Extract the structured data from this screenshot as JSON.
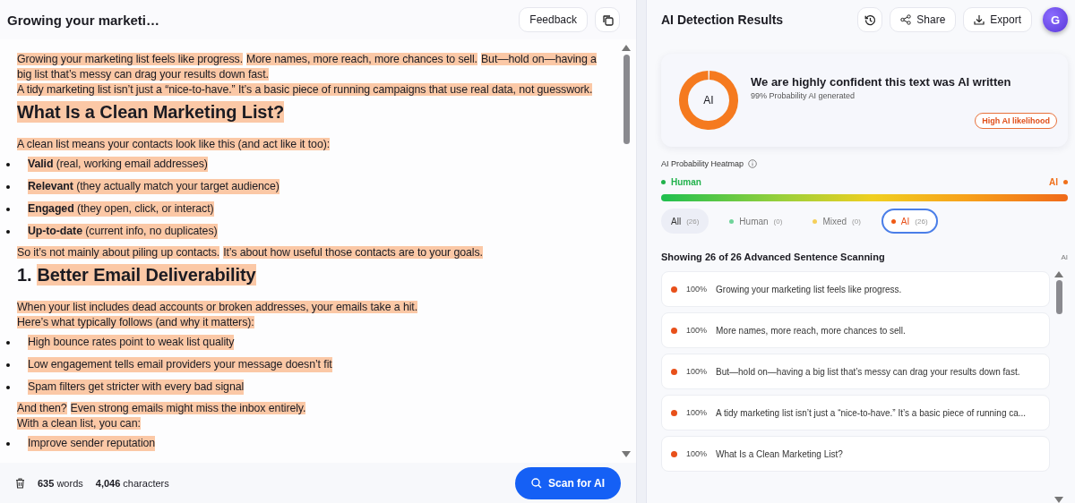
{
  "editor": {
    "title": "Growing your marketi…",
    "feedback_button": "Feedback",
    "blocks": [
      {
        "kind": "paragraph",
        "highlighted": true,
        "lines": [
          [
            "Growing your marketing list feels like progress.",
            "More names, more reach, more chances to sell.",
            "But—hold on—having a big list that’s messy can drag your results down fast."
          ],
          [
            "A tidy marketing list isn’t just a “nice-to-have.” It’s a basic piece of running campaigns that use real data, not guesswork."
          ]
        ]
      },
      {
        "kind": "heading",
        "highlighted": true,
        "text": "What Is a Clean Marketing List?"
      },
      {
        "kind": "paragraph",
        "highlighted": true,
        "lines": [
          [
            "A clean list means your contacts look like this (and act like it too):"
          ]
        ]
      },
      {
        "kind": "bullet",
        "highlighted": true,
        "text": "**Valid** (real, working email addresses)"
      },
      {
        "kind": "bullet",
        "highlighted": true,
        "text": "**Relevant** (they actually match your target audience)"
      },
      {
        "kind": "bullet",
        "highlighted": true,
        "text": "**Engaged** (they open, click, or interact)"
      },
      {
        "kind": "bullet",
        "highlighted": true,
        "text": "**Up-to-date** (current info, no duplicates)"
      },
      {
        "kind": "paragraph",
        "highlighted": true,
        "lines": [
          [
            "So it’s not mainly about piling up contacts.",
            "It’s about how useful those contacts are to your goals."
          ]
        ]
      },
      {
        "kind": "heading",
        "highlighted": true,
        "number": "1.",
        "text": "Better Email Deliverability"
      },
      {
        "kind": "paragraph",
        "highlighted": true,
        "lines": [
          [
            "When your list includes dead accounts or broken addresses, your emails take a hit."
          ],
          [
            "Here’s what typically follows (and why it matters):"
          ]
        ]
      },
      {
        "kind": "bullet",
        "highlighted": true,
        "text": "High bounce rates point to weak list quality"
      },
      {
        "kind": "bullet",
        "highlighted": true,
        "text": "Low engagement tells email providers your message doesn’t fit"
      },
      {
        "kind": "bullet",
        "highlighted": true,
        "text": "Spam filters get stricter with every bad signal"
      },
      {
        "kind": "paragraph",
        "highlighted": true,
        "lines": [
          [
            "And then?",
            "Even strong emails might miss the inbox entirely."
          ],
          [
            "With a clean list, you can:"
          ]
        ]
      },
      {
        "kind": "bullet",
        "highlighted": true,
        "text": "Improve sender reputation"
      }
    ],
    "footer": {
      "words_count": "635",
      "words_label": "words",
      "chars_count": "4,046",
      "chars_label": "characters",
      "scan_button": "Scan for AI"
    }
  },
  "results": {
    "title": "AI Detection Results",
    "share_button": "Share",
    "export_button": "Export",
    "avatar": "G",
    "summary": {
      "donut_label": "AI",
      "level": 0.99,
      "headline": "We are highly confident this text was AI written",
      "subline": "99% Probability AI generated",
      "badge": "High AI likelihood"
    },
    "heatmap": {
      "title": "AI Probability Heatmap",
      "left_label": "Human",
      "right_label": "AI"
    },
    "filters": [
      {
        "label": "All",
        "count": "(26)",
        "selected": false
      },
      {
        "label": "Human",
        "count": "(0)",
        "color": "#6fd49a",
        "selected": false
      },
      {
        "label": "Mixed",
        "count": "(0)",
        "color": "#f5cf5a",
        "selected": false
      },
      {
        "label": "AI",
        "count": "(26)",
        "color": "#f05a14",
        "selected": true
      }
    ],
    "list_title": "Showing 26 of 26 Advanced Sentence Scanning",
    "list_tag": "AI",
    "sentences": [
      {
        "percent": "100%",
        "text": "Growing your marketing list feels like progress.",
        "color": "#e8501a"
      },
      {
        "percent": "100%",
        "text": "More names, more reach, more chances to sell.",
        "color": "#e8501a"
      },
      {
        "percent": "100%",
        "text": "But—hold on—having a big list that’s messy can drag your results down fast.",
        "color": "#e8501a"
      },
      {
        "percent": "100%",
        "text": "A tidy marketing list isn’t just a “nice-to-have.” It’s a basic piece of running ca...",
        "color": "#e8501a"
      },
      {
        "percent": "100%",
        "text": "What Is a Clean Marketing List?",
        "color": "#e8501a"
      }
    ]
  }
}
